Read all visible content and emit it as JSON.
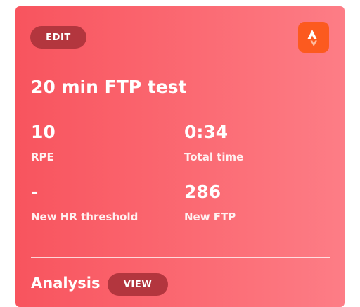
{
  "card": {
    "edit_label": "EDIT",
    "logo_icon": "strava-logo-icon",
    "title": "20 min FTP test",
    "stats": [
      {
        "value": "10",
        "label": "RPE"
      },
      {
        "value": "0:34",
        "label": "Total time"
      },
      {
        "value": "-",
        "label": "New HR threshold"
      },
      {
        "value": "286",
        "label": "New FTP"
      }
    ],
    "analysis_label": "Analysis",
    "view_label": "VIEW"
  },
  "colors": {
    "card_gradient_start": "#f8545e",
    "card_gradient_end": "#fd7d86",
    "button_bg": "#b3363e",
    "logo_bg": "#fc5a1f"
  }
}
